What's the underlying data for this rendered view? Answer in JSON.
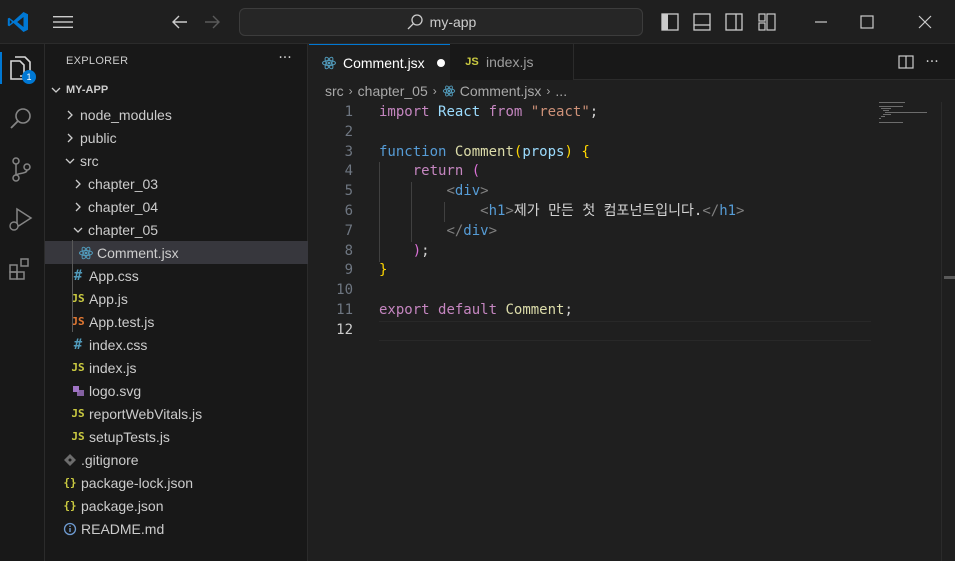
{
  "titlebar": {
    "search_text": "my-app",
    "logo_icon": "vscode-logo-icon",
    "accent": "#0078d4"
  },
  "activity": {
    "explorer_badge": "1"
  },
  "explorer": {
    "title": "EXPLORER",
    "more": "···",
    "root": "MY-APP",
    "items": [
      {
        "label": "node_modules",
        "kind": "folder",
        "icon": ""
      },
      {
        "label": "public",
        "kind": "folder",
        "icon": ""
      },
      {
        "label": "src",
        "kind": "folder-open",
        "icon": ""
      },
      {
        "label": "chapter_03",
        "kind": "folder",
        "icon": ""
      },
      {
        "label": "chapter_04",
        "kind": "folder",
        "icon": ""
      },
      {
        "label": "chapter_05",
        "kind": "folder-open",
        "icon": ""
      },
      {
        "label": "Comment.jsx",
        "kind": "react",
        "icon": "react-icon"
      },
      {
        "label": "App.css",
        "kind": "css",
        "icon": "#"
      },
      {
        "label": "App.js",
        "kind": "js",
        "icon": "JS"
      },
      {
        "label": "App.test.js",
        "kind": "jstest",
        "icon": "JS"
      },
      {
        "label": "index.css",
        "kind": "css",
        "icon": "#"
      },
      {
        "label": "index.js",
        "kind": "js",
        "icon": "JS"
      },
      {
        "label": "logo.svg",
        "kind": "svg",
        "icon": "svg-icon"
      },
      {
        "label": "reportWebVitals.js",
        "kind": "js",
        "icon": "JS"
      },
      {
        "label": "setupTests.js",
        "kind": "js",
        "icon": "JS"
      },
      {
        "label": ".gitignore",
        "kind": "git",
        "icon": "git-icon"
      },
      {
        "label": "package-lock.json",
        "kind": "json",
        "icon": "{}"
      },
      {
        "label": "package.json",
        "kind": "json",
        "icon": "{}"
      },
      {
        "label": "README.md",
        "kind": "info",
        "icon": "info-icon"
      }
    ]
  },
  "tabs": [
    {
      "label": "Comment.jsx",
      "icon": "react-icon",
      "active": true,
      "dirty": true
    },
    {
      "label": "index.js",
      "icon": "JS",
      "active": false,
      "dirty": false
    }
  ],
  "tab_actions": {
    "more": "···"
  },
  "breadcrumb": [
    "src",
    "chapter_05",
    "Comment.jsx",
    "..."
  ],
  "editor": {
    "current_line": 12,
    "lines": [
      {
        "n": "1",
        "text": "import React from \"react\";"
      },
      {
        "n": "2",
        "text": ""
      },
      {
        "n": "3",
        "text": "function Comment(props) {"
      },
      {
        "n": "4",
        "text": "    return ("
      },
      {
        "n": "5",
        "text": "        <div>"
      },
      {
        "n": "6",
        "text": "            <h1>제가 만든 첫 컴포넌트입니다.</h1>"
      },
      {
        "n": "7",
        "text": "        </div>"
      },
      {
        "n": "8",
        "text": "    );"
      },
      {
        "n": "9",
        "text": "}"
      },
      {
        "n": "10",
        "text": ""
      },
      {
        "n": "11",
        "text": "export default Comment;"
      },
      {
        "n": "12",
        "text": ""
      }
    ]
  },
  "colors": {
    "background": "#1f1f1f",
    "sidebar": "#181818",
    "selection": "#37373d",
    "keyword": "#c586c0",
    "storage": "#569cd6",
    "identifier": "#9cdcfe",
    "function": "#dcdcaa",
    "string": "#ce9178",
    "bracket1": "#ffd700",
    "bracket2": "#da70d6",
    "js_icon": "#cbcb41",
    "css_icon": "#519aba",
    "react_icon": "#519aba",
    "jsx_test_icon": "#e37933",
    "svg_icon": "#a074c4",
    "json_icon": "#cbcb41"
  }
}
